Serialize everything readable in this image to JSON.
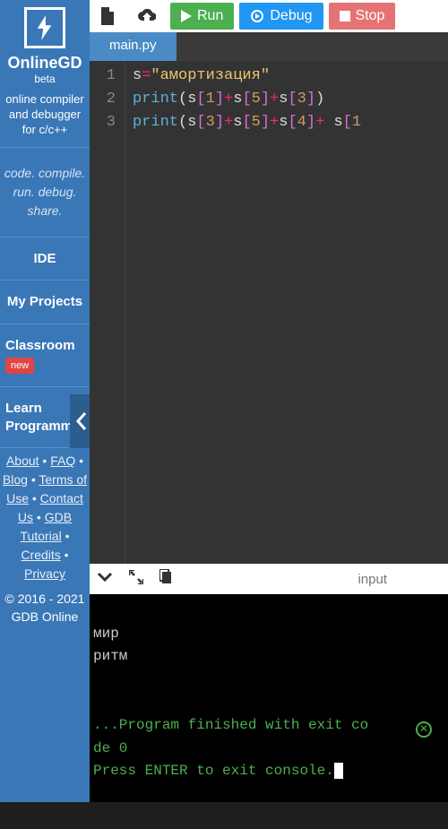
{
  "brand": {
    "name": "OnlineGD",
    "beta": "beta"
  },
  "tagline": "online compiler and debugger for c/c++",
  "motto": "code. compile. run. debug. share.",
  "nav": {
    "ide": "IDE",
    "projects": "My Projects",
    "classroom": "Classroom",
    "classroom_badge": "new",
    "learn": "Learn Programming"
  },
  "footer": {
    "about": "About",
    "faq": "FAQ",
    "blog": "Blog",
    "terms": "Terms of Use",
    "contact": "Contact Us",
    "tutorial": "GDB Tutorial",
    "credits": "Credits",
    "privacy": "Privacy"
  },
  "copyright": "© 2016 - 2021 GDB Online",
  "toolbar": {
    "run": "Run",
    "debug": "Debug",
    "stop": "Stop"
  },
  "tabs": {
    "active": "main.py"
  },
  "code": {
    "string_literal": "\"амортизация\"",
    "line1_var": "s",
    "line2_indices": [
      "1",
      "5",
      "3"
    ],
    "line3_indices": [
      "3",
      "5",
      "4",
      "1"
    ]
  },
  "console_bar": {
    "input": "input"
  },
  "output": {
    "line1": "мир",
    "line2": "ритм",
    "exit1": "...Program finished with exit co",
    "exit2": "de 0",
    "prompt": "Press ENTER to exit console."
  }
}
